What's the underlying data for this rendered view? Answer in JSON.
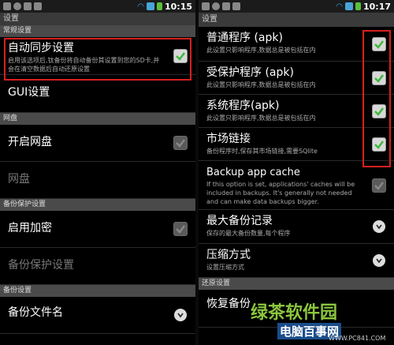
{
  "left": {
    "statusbar": {
      "time": "10:15"
    },
    "title": "设置",
    "sec_general": "常规设置",
    "autosync": {
      "title": "自动同步设置",
      "summary": "启用该选项后,钛备份将自动备份其设置到您的SD卡,并会在清空数据后自动还原设置"
    },
    "gui": {
      "title": "GUI设置"
    },
    "sec_netdisk": "网盘",
    "open_disk": {
      "title": "开启网盘"
    },
    "netdisk": {
      "title": "网盘"
    },
    "sec_backup_protect": "备份保护设置",
    "encrypt": {
      "title": "启用加密"
    },
    "backup_protect": {
      "title": "备份保护设置"
    },
    "sec_backup": "备份设置",
    "partial_item": {
      "title": "备份文件名"
    }
  },
  "right": {
    "statusbar": {
      "time": "10:17"
    },
    "title": "设置",
    "items": [
      {
        "title": "普通程序 (apk)",
        "summary": "此设置只影响程序,数据总是被包括在内",
        "checked": true
      },
      {
        "title": "受保护程序 (apk)",
        "summary": "此设置只影响程序,数据总是被包括在内",
        "checked": true
      },
      {
        "title": "系统程序(apk)",
        "summary": "此设置只影响程序,数据总是被包括在内",
        "checked": true
      },
      {
        "title": "市场链接",
        "summary": "备份程序时,保存其市场链接,需要SQlite",
        "checked": true
      }
    ],
    "cache": {
      "title": "Backup app cache",
      "summary": "If this option is set, applications' caches will be included in backups. It's generally not needed and can make data backups bigger."
    },
    "max_backups": {
      "title": "最大备份记录",
      "summary": "保存的最大备份数量,每个程序"
    },
    "compression": {
      "title": "压缩方式",
      "summary": "设置压缩方式"
    },
    "sec_restore": "还原设置",
    "partial_item": {
      "title": "恢复备份"
    }
  },
  "watermark": {
    "brand": "绿茶软件园",
    "site": "电脑百事网",
    "url": "WWW.PC841.COM"
  },
  "colors": {
    "highlight": "#d62020",
    "check": "#3db83d"
  }
}
